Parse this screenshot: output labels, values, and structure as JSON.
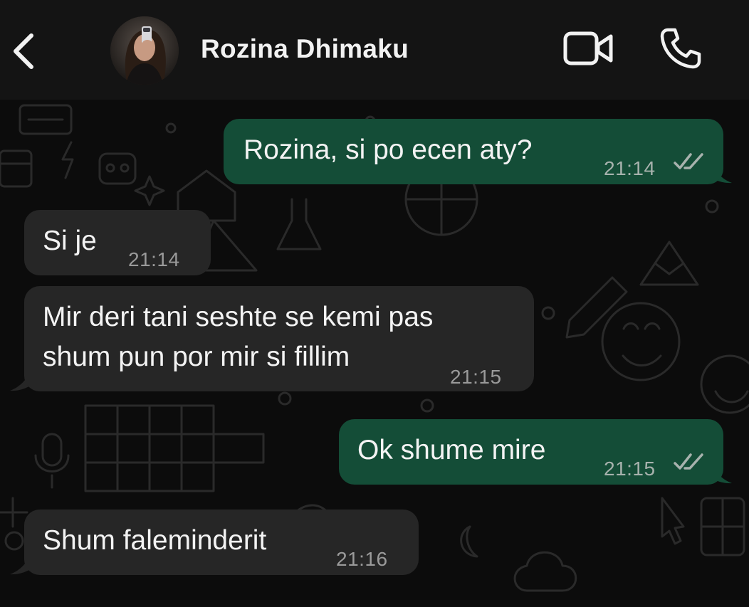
{
  "header": {
    "contact_name": "Rozina Dhimaku",
    "back_icon": "chevron-left-icon",
    "video_icon": "video-camera-icon",
    "call_icon": "phone-icon"
  },
  "messages": [
    {
      "direction": "outgoing",
      "text": "Rozina, si po ecen aty?",
      "time": "21:14",
      "status": "read"
    },
    {
      "direction": "incoming",
      "text": "Si je",
      "time": "21:14"
    },
    {
      "direction": "incoming",
      "text": "Mir deri tani seshte se kemi pas\nshum pun por mir si fillim",
      "time": "21:15"
    },
    {
      "direction": "outgoing",
      "text": "Ok shume mire",
      "time": "21:15",
      "status": "read"
    },
    {
      "direction": "incoming",
      "text": "Shum faleminderit",
      "time": "21:16"
    }
  ],
  "colors": {
    "outgoing_bubble": "#144d37",
    "incoming_bubble": "#262626",
    "header_bg": "#141414",
    "chat_bg": "#0c0c0c",
    "read_ticks": "#a7b2ad"
  }
}
